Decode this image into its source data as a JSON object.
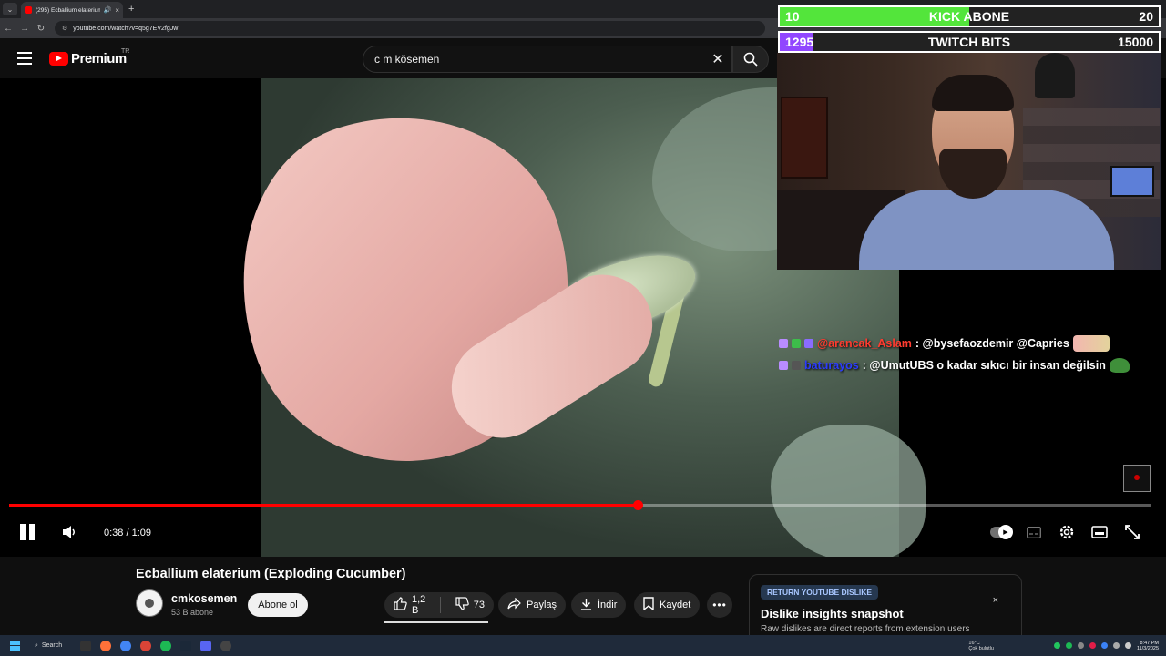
{
  "browser": {
    "tab_title": "(295) Ecballium elaterium (E",
    "url": "youtube.com/watch?v=q5g7EV2fgJw",
    "new_tab": "+",
    "tab_close": "×"
  },
  "youtube": {
    "logo_text": "Premium",
    "region": "TR",
    "search_value": "c m kösemen"
  },
  "overlay": {
    "goals": [
      {
        "current": "10",
        "label": "KICK ABONE",
        "target": "20",
        "fill_fraction": 0.5,
        "color": "#53e53b"
      },
      {
        "current": "1295",
        "label": "TWITCH BITS",
        "target": "15000",
        "fill_fraction": 0.09,
        "color": "#9146ff"
      }
    ],
    "chat": [
      {
        "user": "@arancak_Aslam",
        "message": ": @bysefaozdemir @Capries",
        "user_color": "#ff3b2f"
      },
      {
        "user": "baturayos",
        "message": ": @UmutUBS o kadar sıkıcı bir insan değilsin",
        "user_color": "#2c3cff"
      }
    ]
  },
  "player": {
    "time": "0:38 / 1:09",
    "progress_fraction": 0.551
  },
  "video": {
    "title": "Ecballium elaterium (Exploding Cucumber)",
    "channel": "cmkosemen",
    "subscribers": "53 B abone",
    "subscribe_label": "Abone ol",
    "likes": "1,2 B",
    "dislikes": "73",
    "share_label": "Paylaş",
    "download_label": "İndir",
    "save_label": "Kaydet"
  },
  "ryd": {
    "tag": "RETURN YOUTUBE DISLIKE",
    "title": "Dislike insights snapshot",
    "description": "Raw dislikes are direct reports from extension users",
    "close": "×"
  },
  "taskbar": {
    "search_label": "Search",
    "weather_temp": "16°C",
    "weather_desc": "Çok bulutlu",
    "time": "8:47 PM",
    "date": "11/3/2025"
  }
}
